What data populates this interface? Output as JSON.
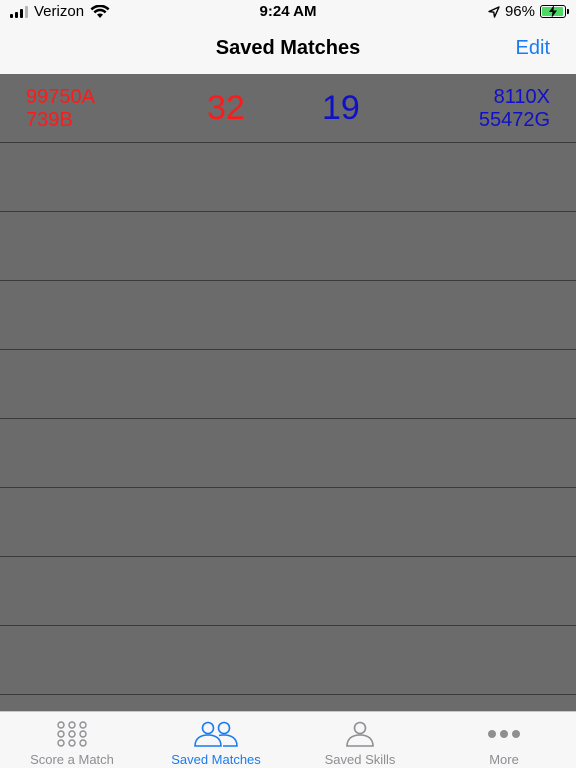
{
  "status_bar": {
    "carrier": "Verizon",
    "time": "9:24 AM",
    "battery_percent": "96%",
    "battery_level": 0.96
  },
  "nav": {
    "title": "Saved Matches",
    "edit_label": "Edit"
  },
  "matches": [
    {
      "red_teams": [
        "99750A",
        "739B"
      ],
      "red_score": "32",
      "blue_score": "19",
      "blue_teams": [
        "8110X",
        "55472G"
      ]
    }
  ],
  "tabs": [
    {
      "label": "Score a Match",
      "icon": "grid-dots-icon",
      "active": false
    },
    {
      "label": "Saved Matches",
      "icon": "two-people-icon",
      "active": true
    },
    {
      "label": "Saved Skills",
      "icon": "person-icon",
      "active": false
    },
    {
      "label": "More",
      "icon": "more-dots-icon",
      "active": false
    }
  ],
  "colors": {
    "accent": "#1a7cf0",
    "red_alliance": "#ff1a1a",
    "blue_alliance": "#1010c8",
    "table_background": "#6b6b6b"
  }
}
